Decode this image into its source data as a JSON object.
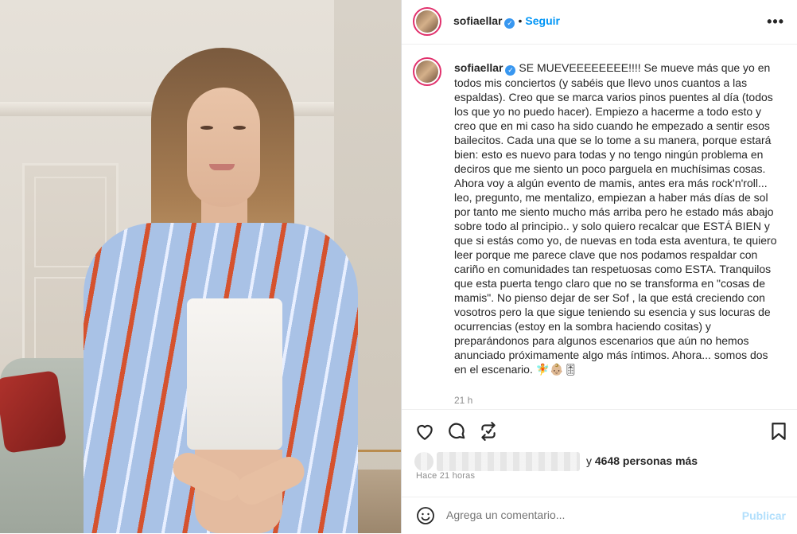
{
  "post": {
    "username": "sofiaellar",
    "follow_label": "Seguir",
    "separator": "•",
    "more_label": "•••",
    "caption_username": "sofiaellar",
    "caption": "SE MUEVEEEEEEEE!!!! Se mueve más que yo en todos mis conciertos (y sabéis que llevo unos cuantos a las espaldas). Creo que se marca varios pinos puentes al día (todos los que yo no puedo hacer). Empiezo a hacerme a todo esto y creo que en mi caso ha sido cuando he empezado a sentir esos bailecitos. Cada una que se lo tome a su manera, porque estará bien: esto es nuevo para todas y no tengo ningún problema en deciros que me siento un poco parguela en muchísimas cosas. Ahora voy a algún evento de mamis, antes era más rock'n'roll... leo, pregunto, me mentalizo, empiezan a haber más días de sol por tanto me siento mucho más arriba pero he estado más abajo sobre todo al principio.. y solo quiero recalcar que ESTÁ BIEN y que si estás como yo, de nuevas en toda esta aventura, te quiero leer porque me parece clave que nos podamos respaldar con cariño en comunidades tan respetuosas como ESTA. Tranquilos que esta puerta tengo claro que no se transforma en \"cosas de mamis\". No pienso dejar de ser Sof , la que está creciendo con vosotros pero la que sigue teniendo su esencia y sus locuras de ocurrencias (estoy en la sombra haciendo cositas) y preparándonos para algunos escenarios que aún no hemos anunciado próximamente algo más íntimos. Ahora... somos dos en el escenario. 🧚👶🏼🎚",
    "caption_time": "21 h",
    "likes_prefix": "y",
    "likes_count": "4648 personas más",
    "posted_ago": "Hace 21 horas",
    "comment_placeholder": "Agrega un comentario...",
    "publish_label": "Publicar"
  },
  "icons": [
    "heart-icon",
    "comment-icon",
    "repost-icon",
    "bookmark-icon",
    "emoji-icon",
    "verified-icon",
    "more-options-icon"
  ],
  "colors": {
    "accent_blue": "#0095f6",
    "publish_disabled": "#b2dffc",
    "verified": "#3897f0",
    "text": "#262626",
    "muted": "#8e8e8e"
  }
}
